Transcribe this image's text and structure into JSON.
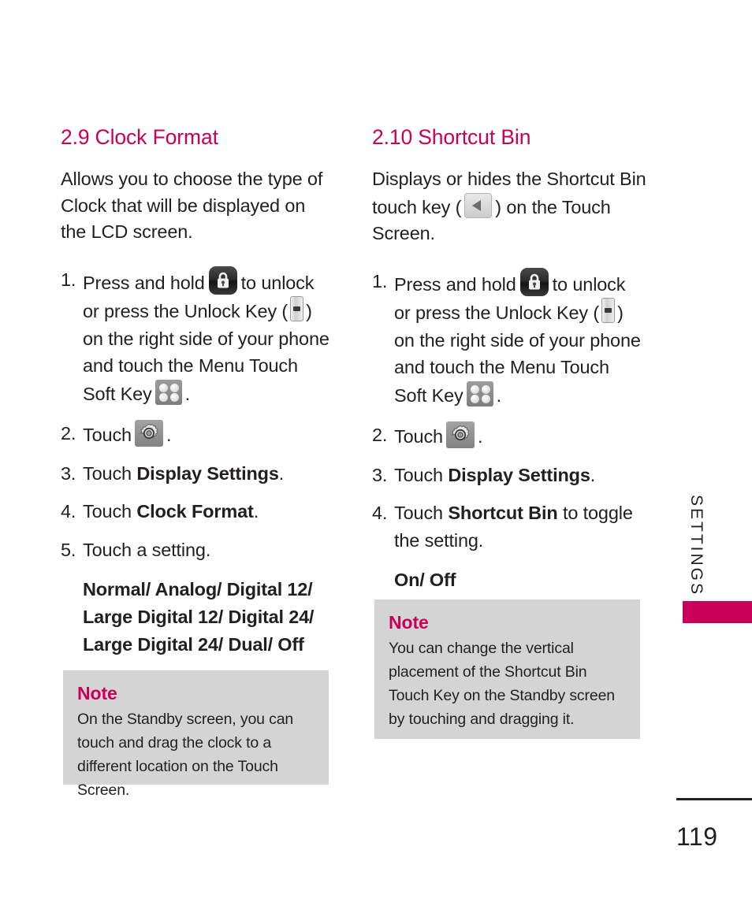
{
  "document": {
    "page_number": "119",
    "side_label": "SETTINGS",
    "accent_color": "#c8005a",
    "note_bg_color": "#d4d4d4",
    "text_color": "#231f20"
  },
  "left_column": {
    "section_number": "2.9",
    "section_title": "Clock Format",
    "intro": "Allows you to choose the type of Clock that will be displayed on the LCD screen.",
    "steps": [
      {
        "marker": "1.",
        "part1": "Press and hold",
        "icon1": "lock-icon",
        "part2": "to unlock or press the Unlock Key (",
        "icon2": "unlock-key-icon",
        "part3": ") on the right side of your phone and touch the Menu Touch Soft Key",
        "icon3": "menu-soft-key-icon",
        "part4": "."
      },
      {
        "marker": "2.",
        "part1": "Touch",
        "icon1": "settings-gear-icon",
        "part2": "."
      },
      {
        "marker": "3.",
        "part1": "Touch",
        "bold": "Display Settings",
        "part2": "."
      },
      {
        "marker": "4.",
        "part1": "Touch",
        "bold": "Clock Format",
        "part2": "."
      },
      {
        "marker": "5.",
        "part1": "Touch a setting.",
        "bold": "",
        "part2": ""
      }
    ],
    "options": "Normal/ Analog/ Digital 12/ Large Digital 12/ Digital 24/ Large Digital 24/ Dual/ Off",
    "note": {
      "title": "Note",
      "body": "On the Standby screen, you can touch and drag the clock to a different location on the Touch Screen."
    }
  },
  "right_column": {
    "section_number": "2.10",
    "section_title": "Shortcut Bin",
    "intro_part1": "Displays or hides the Shortcut Bin touch key (",
    "intro_icon": "shortcut-bin-key-icon",
    "intro_part2": ") on the Touch Screen.",
    "steps": [
      {
        "marker": "1.",
        "part1": "Press and hold",
        "icon1": "lock-icon",
        "part2": "to unlock or press the Unlock Key (",
        "icon2": "unlock-key-icon",
        "part3": ") on the right side of your phone and touch the Menu Touch Soft Key",
        "icon3": "menu-soft-key-icon",
        "part4": "."
      },
      {
        "marker": "2.",
        "part1": "Touch",
        "icon1": "settings-gear-icon",
        "part2": "."
      },
      {
        "marker": "3.",
        "part1": "Touch",
        "bold": "Display Settings",
        "part2": "."
      },
      {
        "marker": "4.",
        "part1": "Touch",
        "bold": "Shortcut Bin",
        "part2": " to toggle the setting."
      }
    ],
    "options": "On/ Off",
    "note": {
      "title": "Note",
      "body": "You can change the vertical placement of the Shortcut Bin Touch Key on the Standby screen by touching and dragging it."
    }
  }
}
